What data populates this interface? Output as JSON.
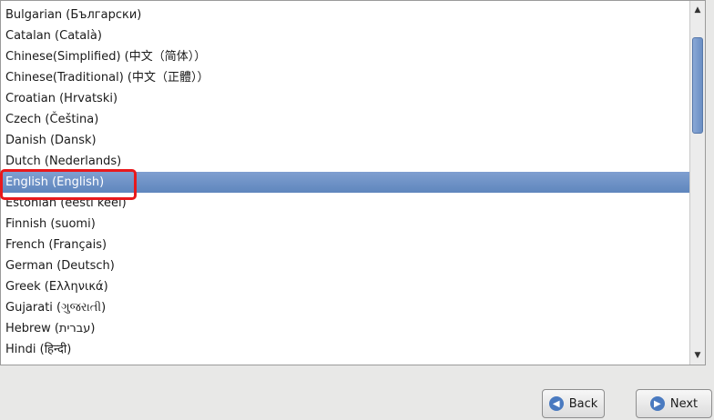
{
  "language_list": {
    "items": [
      "Bulgarian (Български)",
      "Catalan (Català)",
      "Chinese(Simplified) (中文（简体））",
      "Chinese(Traditional) (中文（正體））",
      "Croatian (Hrvatski)",
      "Czech (Čeština)",
      "Danish (Dansk)",
      "Dutch (Nederlands)",
      "English (English)",
      "Estonian (eesti keel)",
      "Finnish (suomi)",
      "French (Français)",
      "German (Deutsch)",
      "Greek (Ελληνικά)",
      "Gujarati (ગુજરાતી)",
      "Hebrew (עברית)",
      "Hindi (हिन्दी)"
    ],
    "selected": "English (English)"
  },
  "scrollbar": {
    "up_icon": "▲",
    "down_icon": "▼"
  },
  "footer": {
    "back_label": "Back",
    "back_icon": "◀",
    "next_label": "Next",
    "next_icon": "▶"
  },
  "colors": {
    "selection": "#6f93c6",
    "highlight_border": "#e8191c"
  }
}
